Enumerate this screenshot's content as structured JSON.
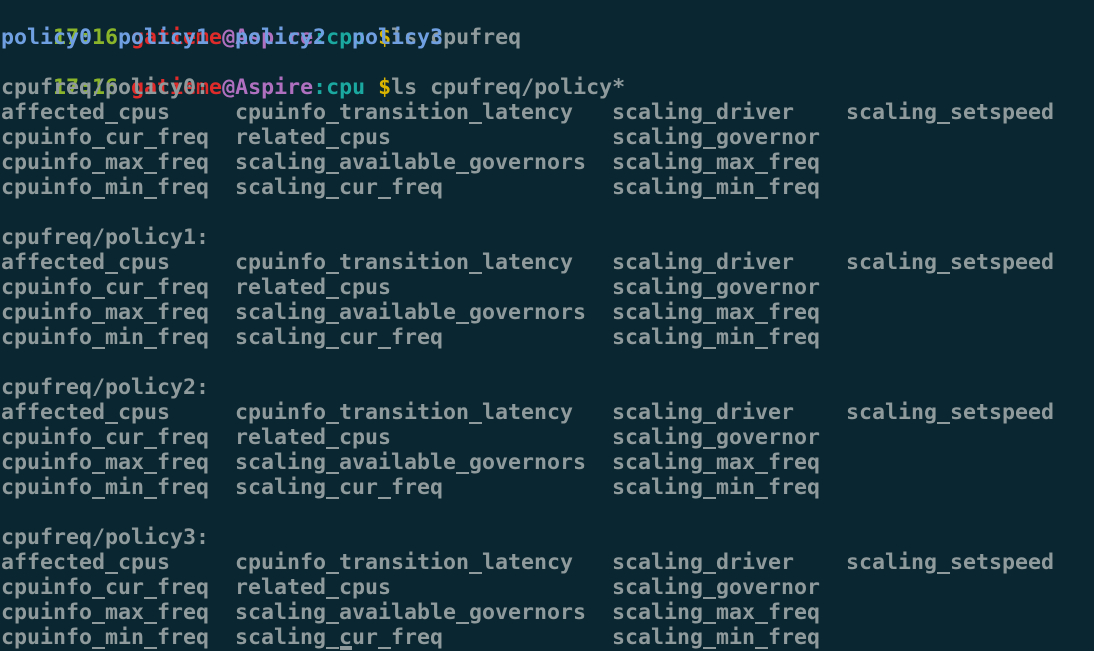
{
  "prompt1": {
    "time": "17:16",
    "user": "gatieme",
    "at": "@",
    "host": "Aspire",
    "colon": ":",
    "cwd": "cpu",
    "dollar": " $",
    "command": "ls cpufreq"
  },
  "ls1_output": [
    "policy0",
    "policy1",
    "policy2",
    "policy3"
  ],
  "prompt2": {
    "time": "17:16",
    "user": "gatieme",
    "at": "@",
    "host": "Aspire",
    "colon": ":",
    "cwd": "cpu",
    "dollar": " $",
    "command": "ls cpufreq/policy*"
  },
  "policies": [
    {
      "header": "cpufreq/policy0:",
      "rows": [
        [
          "affected_cpus",
          "cpuinfo_transition_latency",
          "scaling_driver",
          "scaling_setspeed"
        ],
        [
          "cpuinfo_cur_freq",
          "related_cpus",
          "scaling_governor",
          ""
        ],
        [
          "cpuinfo_max_freq",
          "scaling_available_governors",
          "scaling_max_freq",
          ""
        ],
        [
          "cpuinfo_min_freq",
          "scaling_cur_freq",
          "scaling_min_freq",
          ""
        ]
      ]
    },
    {
      "header": "cpufreq/policy1:",
      "rows": [
        [
          "affected_cpus",
          "cpuinfo_transition_latency",
          "scaling_driver",
          "scaling_setspeed"
        ],
        [
          "cpuinfo_cur_freq",
          "related_cpus",
          "scaling_governor",
          ""
        ],
        [
          "cpuinfo_max_freq",
          "scaling_available_governors",
          "scaling_max_freq",
          ""
        ],
        [
          "cpuinfo_min_freq",
          "scaling_cur_freq",
          "scaling_min_freq",
          ""
        ]
      ]
    },
    {
      "header": "cpufreq/policy2:",
      "rows": [
        [
          "affected_cpus",
          "cpuinfo_transition_latency",
          "scaling_driver",
          "scaling_setspeed"
        ],
        [
          "cpuinfo_cur_freq",
          "related_cpus",
          "scaling_governor",
          ""
        ],
        [
          "cpuinfo_max_freq",
          "scaling_available_governors",
          "scaling_max_freq",
          ""
        ],
        [
          "cpuinfo_min_freq",
          "scaling_cur_freq",
          "scaling_min_freq",
          ""
        ]
      ]
    },
    {
      "header": "cpufreq/policy3:",
      "rows": [
        [
          "affected_cpus",
          "cpuinfo_transition_latency",
          "scaling_driver",
          "scaling_setspeed"
        ],
        [
          "cpuinfo_cur_freq",
          "related_cpus",
          "scaling_governor",
          ""
        ],
        [
          "cpuinfo_max_freq",
          "scaling_available_governors",
          "scaling_max_freq",
          ""
        ],
        [
          "cpuinfo_min_freq",
          "scaling_cur_freq",
          "scaling_min_freq",
          ""
        ]
      ]
    }
  ],
  "colors": {
    "background": "#0a2630",
    "time": "#8ab52a",
    "user": "#e02b2b",
    "host": "#b070c0",
    "cwd": "#1aa8a0",
    "dollar": "#d9b400",
    "directory": "#6f9fe0",
    "text": "#8e9a9c"
  }
}
